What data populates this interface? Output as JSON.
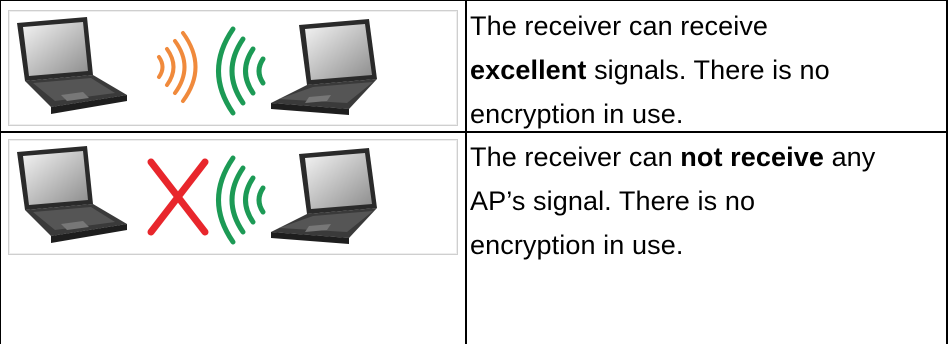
{
  "rows": [
    {
      "icon": "laptops-signal-excellent",
      "parts": {
        "a": "The receiver can receive",
        "b": "excellent",
        "c": " signals. There is no",
        "d": "encryption in use."
      },
      "colors": {
        "sender_wave": "#f08a3c",
        "receiver_wave": "#1c9a55"
      }
    },
    {
      "icon": "laptops-signal-none",
      "parts": {
        "a": "The receiver can ",
        "b": "not receive",
        "c": " any",
        "d": "AP’s signal. There is no",
        "e": "encryption in use."
      },
      "colors": {
        "cross": "#e8262c",
        "receiver_wave": "#1c9a55"
      }
    }
  ]
}
